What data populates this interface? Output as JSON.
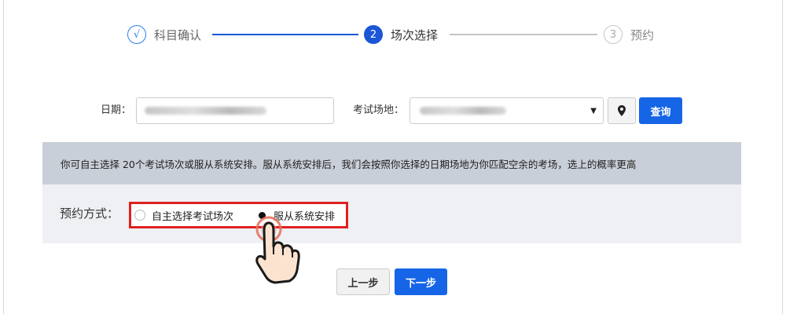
{
  "steps": [
    {
      "marker": "√",
      "label": "科目确认",
      "state": "done"
    },
    {
      "marker": "2",
      "label": "场次选择",
      "state": "active"
    },
    {
      "marker": "3",
      "label": "预约",
      "state": "pending"
    }
  ],
  "query": {
    "date_label": "日期：",
    "venue_label": "考试场地：",
    "query_button": "查询",
    "location_icon": "map-pin-icon",
    "dropdown_icon": "caret-down-icon"
  },
  "info": {
    "notice": "你可自主选择 20个考试场次或服从系统安排。服从系统安排后，我们会按照你选择的日期场地为你匹配空余的考场，选上的概率更高"
  },
  "method": {
    "label": "预约方式：",
    "options": [
      {
        "label": "自主选择考试场次",
        "selected": false
      },
      {
        "label": "服从系统安排",
        "selected": true
      }
    ]
  },
  "nav": {
    "prev_label": "上一步",
    "next_label": "下一步"
  },
  "colors": {
    "primary": "#1565e6",
    "step_active": "#1a56d6",
    "highlight": "#e02020",
    "info_bg": "#c9cfd8",
    "panel_bg": "#eef0f3"
  }
}
